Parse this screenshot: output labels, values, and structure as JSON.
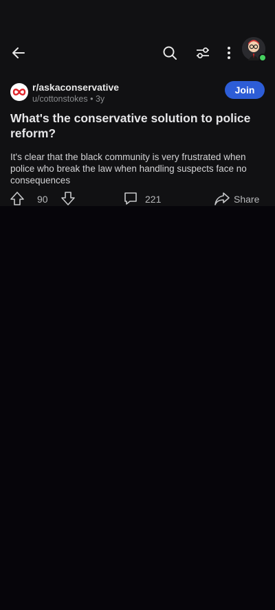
{
  "header": {
    "icons": {
      "back": "back-arrow-icon",
      "search": "search-icon",
      "filter": "sliders-icon",
      "more": "more-vertical-icon",
      "avatar": "avatar"
    },
    "online_status_color": "#46d160"
  },
  "post": {
    "subreddit": "r/askaconservative",
    "author": "u/cottonstokes",
    "age": "3y",
    "join_label": "Join",
    "title": "What's the conservative solution to police reform?",
    "body": "It's clear that the black community is very frustrated when police who break the law when handling suspects face no consequences",
    "votes": "90",
    "comments": "221",
    "share_label": "Share"
  },
  "colors": {
    "background": "#06050a",
    "card": "#111113",
    "join_button": "#2d5dd7",
    "subreddit_icon_accent": "#e0242a"
  }
}
